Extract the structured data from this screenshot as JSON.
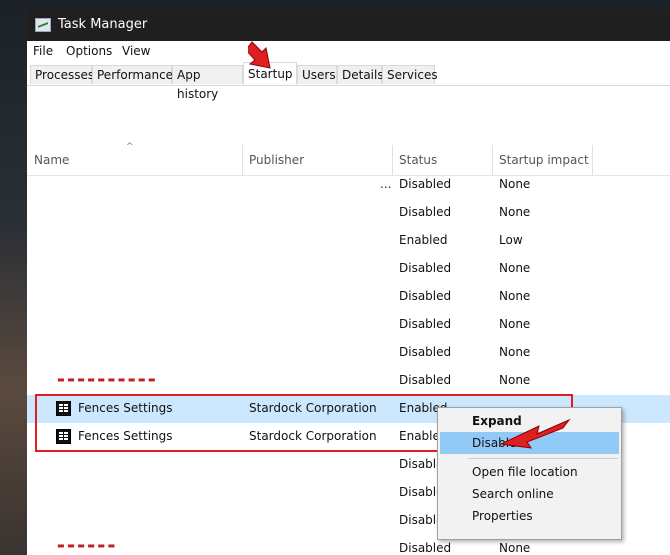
{
  "window": {
    "title": "Task Manager"
  },
  "menu": {
    "file": "File",
    "options": "Options",
    "view": "View"
  },
  "tabs": [
    {
      "label": "Processes"
    },
    {
      "label": "Performance"
    },
    {
      "label": "App history"
    },
    {
      "label": "Startup"
    },
    {
      "label": "Users"
    },
    {
      "label": "Details"
    },
    {
      "label": "Services"
    }
  ],
  "columns": {
    "name": "Name",
    "publisher": "Publisher",
    "status": "Status",
    "impact": "Startup impact"
  },
  "rows": [
    {
      "name": "",
      "publisher": "",
      "status": "Disabled",
      "impact": "None"
    },
    {
      "name": "",
      "publisher": "",
      "status": "Disabled",
      "impact": "None"
    },
    {
      "name": "",
      "publisher": "",
      "status": "Enabled",
      "impact": "Low"
    },
    {
      "name": "",
      "publisher": "",
      "status": "Disabled",
      "impact": "None"
    },
    {
      "name": "",
      "publisher": "",
      "status": "Disabled",
      "impact": "None"
    },
    {
      "name": "",
      "publisher": "",
      "status": "Disabled",
      "impact": "None"
    },
    {
      "name": "",
      "publisher": "",
      "status": "Disabled",
      "impact": "None"
    },
    {
      "name": "",
      "publisher": "",
      "status": "Disabled",
      "impact": "None"
    },
    {
      "name": "Fences Settings",
      "publisher": "Stardock Corporation",
      "status": "Enabled",
      "impact": ""
    },
    {
      "name": "Fences Settings",
      "publisher": "Stardock Corporation",
      "status": "Enabled",
      "impact": ""
    },
    {
      "name": "",
      "publisher": "",
      "status": "Disabled",
      "impact": ""
    },
    {
      "name": "",
      "publisher": "",
      "status": "Disabled",
      "impact": ""
    },
    {
      "name": "",
      "publisher": "",
      "status": "Disabled",
      "impact": ""
    },
    {
      "name": "",
      "publisher": "",
      "status": "Disabled",
      "impact": "None"
    }
  ],
  "context_menu": {
    "expand": "Expand",
    "disable": "Disable",
    "open_file_location": "Open file location",
    "search_online": "Search online",
    "properties": "Properties"
  },
  "colors": {
    "selected_row": "#cce8ff",
    "menu_hover": "#91c9f7",
    "annotation_red": "#e02020"
  }
}
